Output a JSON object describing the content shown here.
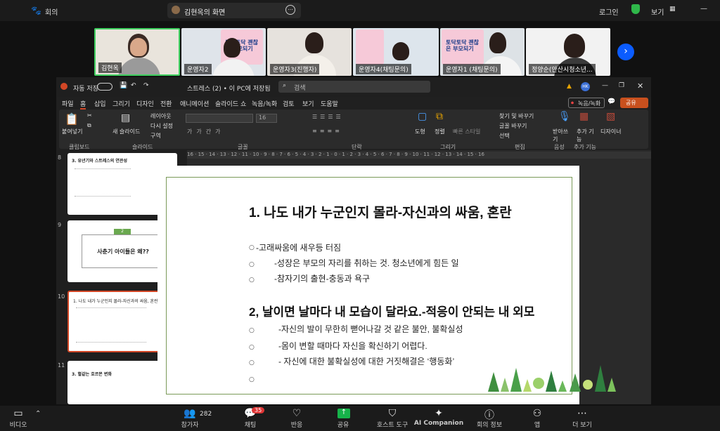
{
  "topbar": {
    "meeting": "회의",
    "share_title": "김현옥의 화면",
    "login": "로그인",
    "view": "보기"
  },
  "gallery": {
    "participants": [
      {
        "name": "김현옥"
      },
      {
        "name": "운영자2"
      },
      {
        "name": "운영자3(진행자)"
      },
      {
        "name": "운영자4(채팅문의)"
      },
      {
        "name": "운영자1 (채팅문의)"
      },
      {
        "name": "정양순(안산시청소년..."
      }
    ],
    "posters": [
      "토닥토닥 괜찮은 부모되기",
      "토닥토닥 괜찮은 부모되기"
    ]
  },
  "ppt": {
    "autosave": "자동 저장",
    "doc_title": "스트레스 (2) • 이 PC에 저장됨",
    "search": "검색",
    "avatar": "HK",
    "record": "녹음/녹화",
    "share": "공유",
    "tabs": [
      "파일",
      "홈",
      "삽입",
      "그리기",
      "디자인",
      "전환",
      "애니메이션",
      "슬라이드 쇼",
      "녹음/녹화",
      "검토",
      "보기",
      "도움말"
    ],
    "ribbon": {
      "paste": "붙여넣기",
      "new_slide": "새 슬라이드",
      "layout": "레이아웃",
      "reset": "다시 설정",
      "section": "구역",
      "font_size": "16",
      "draw": "도형",
      "arrange": "정렬",
      "quick_style": "빠른 스타일",
      "find": "찾기 및 바꾸기",
      "replace": "글꼴 바꾸기",
      "select": "선택",
      "dictate": "받아쓰기",
      "addins": "추가 기능",
      "designer": "디자이너",
      "groups": [
        "클립보드",
        "슬라이드",
        "글꼴",
        "단락",
        "그리기",
        "편집",
        "음성",
        "추가 기능"
      ]
    },
    "ruler": "16 · 15 · 14 · 13 · 12 · 11 · 10 · 9 · 8 · 7 · 6 · 5 · 4 · 3 · 2 · 1 · 0 · 1 · 2 · 3 · 4 · 5 · 6 · 7 · 8 · 9 · 10 · 11 · 12 · 13 · 14 · 15 · 16",
    "thumbs": [
      {
        "num": "8",
        "title": "3. 유년기와 스트레스의 연관성"
      },
      {
        "num": "9",
        "title": "사춘기 아이들은 왜??",
        "badge": "2"
      },
      {
        "num": "10",
        "title": "1. 나도 내가 누군인지 몰라-자신과의 싸움, 혼란"
      },
      {
        "num": "11",
        "title": "3. 혈같는 호르몬 변화"
      }
    ],
    "slide": {
      "title1": "1. 나도 내가 누군인지 몰라-자신과의 싸움, 혼란",
      "lines1": [
        "-고래싸움에 새우등 터짐",
        "-성장은 부모의 자리를 취하는 것. 청소년에게 힘든 일",
        "-참자기의 출현-충동과 욕구"
      ],
      "title2": "2, 날이면 날마다 내 모습이 달라요.-적응이 안되는 내 외모",
      "lines2": [
        "-자신의 발이 무한히 뻗어나갈 것 같은 불안, 불확실성",
        "-몸이 변할 때마다 자신을 확신하기 어렵다.",
        "- 자신에 대한 불확실성에 대한 거짓해결은 ‘행동화’",
        ""
      ]
    }
  },
  "bottombar": {
    "video": "비디오",
    "participants": "참가자",
    "participants_count": "282",
    "chat": "채팅",
    "chat_badge": "35",
    "react": "반응",
    "share": "공유",
    "host_tools": "호스트 도구",
    "ai": "AI Companion",
    "info": "회의 정보",
    "apps": "앱",
    "more": "더 보기"
  }
}
